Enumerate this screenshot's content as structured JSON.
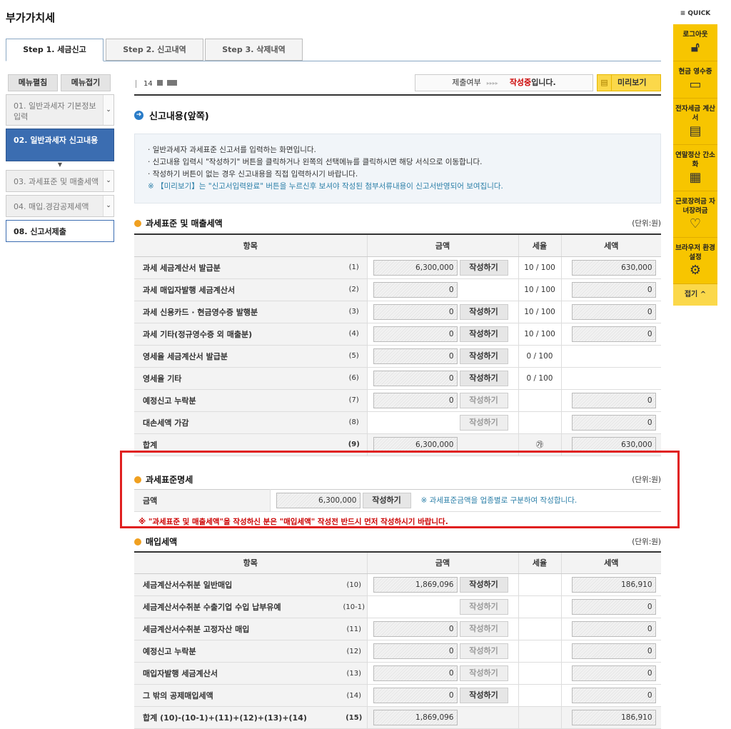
{
  "page_title": "부가가치세",
  "tabs": [
    "Step 1. 세금신고",
    "Step 2. 신고내역",
    "Step 3. 삭제내역"
  ],
  "sidebar": {
    "expand": "메뉴펼침",
    "collapse": "메뉴접기",
    "items": [
      "01. 일반과세자 기본정보 입력",
      "02. 일반과세자 신고내용",
      "03. 과세표준 및 매출세액",
      "04. 매입.경감공제세액",
      "08. 신고서제출"
    ]
  },
  "topbar": {
    "user_id": "14",
    "status_label": "제출여부",
    "status_value": "작성중",
    "status_suffix": "입니다.",
    "preview": "미리보기"
  },
  "section_title": "신고내용(앞쪽)",
  "info": [
    "일반과세자 과세표준 신고서를 입력하는 화면입니다.",
    "신고내용 입력시 \"작성하기\" 버튼을 클릭하거나 왼쪽의 선택메뉴를 클릭하시면 해당 서식으로 이동합니다.",
    "작성하기 버튼이 없는 경우 신고내용을 직접 입력하시기 바랍니다.",
    "※ 【미리보기】는 \"신고서입력완료\" 버튼을 누르신후 보셔야 작성된 첨부서류내용이 신고서반영되어 보여집니다."
  ],
  "unit": "(단위:원)",
  "write": "작성하기",
  "sales": {
    "title": "과세표준 및 매출세액",
    "headers": [
      "항목",
      "금액",
      "세율",
      "세액"
    ],
    "rows": [
      {
        "label": "과세 세금계산서 발급분",
        "no": "(1)",
        "amount": "6,300,000",
        "rate": "10 / 100",
        "tax": "630,000"
      },
      {
        "label": "과세 매입자발행 세금계산서",
        "no": "(2)",
        "amount": "0",
        "rate": "10 / 100",
        "tax": "0"
      },
      {
        "label": "과세 신용카드 · 현금영수증 발행분",
        "no": "(3)",
        "amount": "0",
        "rate": "10 / 100",
        "tax": "0"
      },
      {
        "label": "과세 기타(정규영수증 외 매출분)",
        "no": "(4)",
        "amount": "0",
        "rate": "10 / 100",
        "tax": "0"
      },
      {
        "label": "영세율 세금계산서 발급분",
        "no": "(5)",
        "amount": "0",
        "rate": "0 / 100",
        "tax": ""
      },
      {
        "label": "영세율 기타",
        "no": "(6)",
        "amount": "0",
        "rate": "0 / 100",
        "tax": ""
      },
      {
        "label": "예정신고 누락분",
        "no": "(7)",
        "amount": "0",
        "rate": "",
        "tax": "0"
      },
      {
        "label": "대손세액 가감",
        "no": "(8)",
        "amount": "",
        "rate": "",
        "tax": "0"
      },
      {
        "label": "합계",
        "no": "(9)",
        "amount": "6,300,000",
        "rate": "㉮",
        "tax": "630,000"
      }
    ]
  },
  "tax_base": {
    "title": "과세표준명세",
    "label": "금액",
    "amount": "6,300,000",
    "note": "※ 과세표준금액을 업종별로 구분하여 작성합니다.",
    "warning": "※ \"과세표준 및 매출세액\"을 작성하신 분은 \"매입세액\" 작성전 반드시 먼저 작성하시기 바랍니다."
  },
  "purchase": {
    "title": "매입세액",
    "headers": [
      "항목",
      "금액",
      "세율",
      "세액"
    ],
    "rows": [
      {
        "label": "세금계산서수취분 일반매입",
        "no": "(10)",
        "amount": "1,869,096",
        "tax": "186,910"
      },
      {
        "label": "세금계산서수취분 수출기업 수입 납부유예",
        "no": "(10-1)",
        "amount": "",
        "tax": "0"
      },
      {
        "label": "세금계산서수취분 고정자산 매입",
        "no": "(11)",
        "amount": "0",
        "tax": "0"
      },
      {
        "label": "예정신고 누락분",
        "no": "(12)",
        "amount": "0",
        "tax": "0"
      },
      {
        "label": "매입자발행 세금계산서",
        "no": "(13)",
        "amount": "0",
        "tax": "0"
      },
      {
        "label": "그 밖의 공제매입세액",
        "no": "(14)",
        "amount": "0",
        "tax": "0"
      },
      {
        "label": "합계 (10)-(10-1)+(11)+(12)+(13)+(14)",
        "no": "(15)",
        "amount": "1,869,096",
        "tax": "186,910"
      }
    ]
  },
  "quick": {
    "title": "≡ QUICK",
    "items": [
      "로그아웃",
      "현금 영수증",
      "전자세금 계산서",
      "연말정산 간소화",
      "근로장려금 자녀장려금",
      "브라우저 환경설정"
    ],
    "fold": "접기 ^"
  }
}
